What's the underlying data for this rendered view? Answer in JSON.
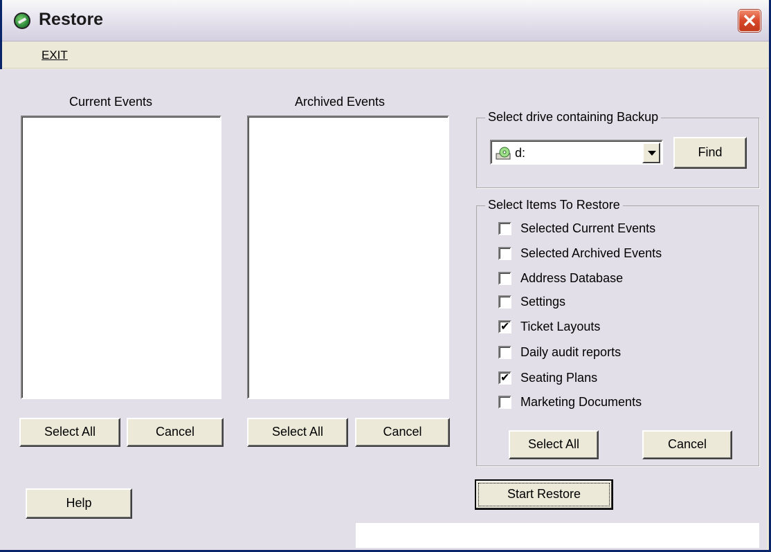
{
  "window": {
    "title": "Restore",
    "close_label": "✕"
  },
  "menu": {
    "exit_label": "EXIT"
  },
  "current_events": {
    "label": "Current Events",
    "select_all": "Select All",
    "cancel": "Cancel"
  },
  "archived_events": {
    "label": "Archived Events",
    "select_all": "Select All",
    "cancel": "Cancel"
  },
  "backup_drive": {
    "group_title": "Select drive containing Backup",
    "selected_drive": "d:",
    "find_label": "Find"
  },
  "restore_items": {
    "group_title": "Select Items To Restore",
    "items": [
      {
        "label": "Selected Current Events",
        "checked": false
      },
      {
        "label": "Selected Archived Events",
        "checked": false
      },
      {
        "label": "Address Database",
        "checked": false
      },
      {
        "label": "Settings",
        "checked": false
      },
      {
        "label": "Ticket Layouts",
        "checked": true
      },
      {
        "label": "Daily audit reports",
        "checked": false
      },
      {
        "label": "Seating Plans",
        "checked": true
      },
      {
        "label": "Marketing Documents",
        "checked": false
      }
    ],
    "select_all": "Select All",
    "cancel": "Cancel"
  },
  "actions": {
    "help_label": "Help",
    "start_restore_label": "Start Restore"
  },
  "colors": {
    "face": "#ece9d8",
    "client": "#e3dfe9",
    "close": "#d8482a"
  }
}
